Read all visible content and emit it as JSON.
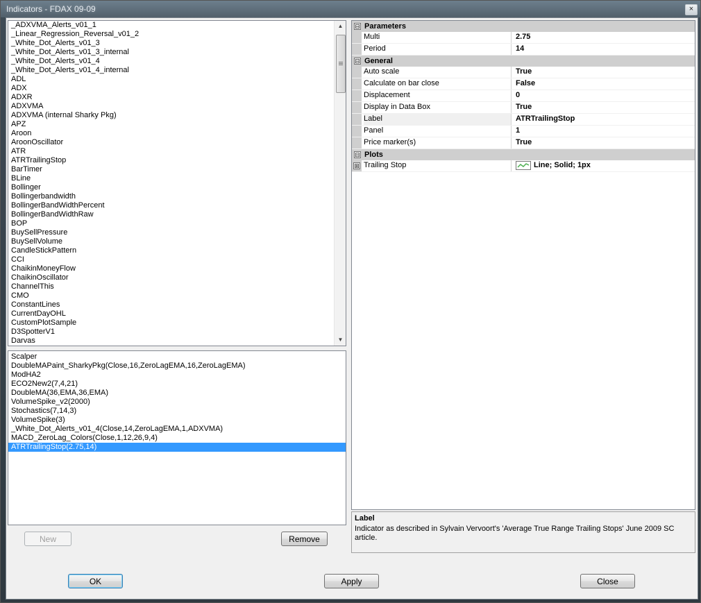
{
  "window": {
    "title": "Indicators - FDAX 09-09",
    "close_glyph": "×"
  },
  "available_indicators": [
    "_ADXVMA_Alerts_v01_1",
    "_Linear_Regression_Reversal_v01_2",
    "_White_Dot_Alerts_v01_3",
    "_White_Dot_Alerts_v01_3_internal",
    "_White_Dot_Alerts_v01_4",
    "_White_Dot_Alerts_v01_4_internal",
    "ADL",
    "ADX",
    "ADXR",
    "ADXVMA",
    "ADXVMA (internal Sharky Pkg)",
    "APZ",
    "Aroon",
    "AroonOscillator",
    "ATR",
    "ATRTrailingStop",
    "BarTimer",
    "BLine",
    "Bollinger",
    "Bollingerbandwidth",
    "BollingerBandWidthPercent",
    "BollingerBandWidthRaw",
    "BOP",
    "BuySellPressure",
    "BuySellVolume",
    "CandleStickPattern",
    "CCI",
    "ChaikinMoneyFlow",
    "ChaikinOscillator",
    "ChannelThis",
    "CMO",
    "ConstantLines",
    "CurrentDayOHL",
    "CustomPlotSample",
    "D3SpotterV1",
    "Darvas"
  ],
  "applied_indicators": [
    "Scalper",
    "DoubleMAPaint_SharkyPkg(Close,16,ZeroLagEMA,16,ZeroLagEMA)",
    "ModHA2",
    "ECO2New2(7,4,21)",
    "DoubleMA(36,EMA,36,EMA)",
    "VolumeSpike_v2(2000)",
    "Stochastics(7,14,3)",
    "VolumeSpike(3)",
    "_White_Dot_Alerts_v01_4(Close,14,ZeroLagEMA,1,ADXVMA)",
    "MACD_ZeroLag_Colors(Close,1,12,26,9,4)",
    "ATRTrailingStop(2.75,14)"
  ],
  "selected_applied_index": 10,
  "buttons": {
    "new": "New",
    "remove": "Remove",
    "ok": "OK",
    "apply": "Apply",
    "close": "Close"
  },
  "properties": {
    "parameters": {
      "title": "Parameters",
      "rows": [
        {
          "name": "Multi",
          "value": "2.75"
        },
        {
          "name": "Period",
          "value": "14"
        }
      ]
    },
    "general": {
      "title": "General",
      "rows": [
        {
          "name": "Auto scale",
          "value": "True"
        },
        {
          "name": "Calculate on bar close",
          "value": "False"
        },
        {
          "name": "Displacement",
          "value": "0"
        },
        {
          "name": "Display in Data Box",
          "value": "True"
        },
        {
          "name": "Label",
          "value": "ATRTrailingStop"
        },
        {
          "name": "Panel",
          "value": "1"
        },
        {
          "name": "Price marker(s)",
          "value": "True"
        }
      ]
    },
    "plots": {
      "title": "Plots",
      "rows": [
        {
          "name": "Trailing Stop",
          "value": "Line; Solid; 1px"
        }
      ]
    }
  },
  "help": {
    "title": "Label",
    "text": "Indicator as described in Sylvain Vervoort's 'Average True Range Trailing Stops' June 2009 SC article."
  },
  "icons": {
    "collapse": "⊟",
    "expand": "⊞",
    "scroll_up": "▲",
    "scroll_down": "▼"
  },
  "colors": {
    "selection": "#3399ff",
    "category_bg": "#cfcfcf",
    "plot_line": "#4caf50"
  }
}
